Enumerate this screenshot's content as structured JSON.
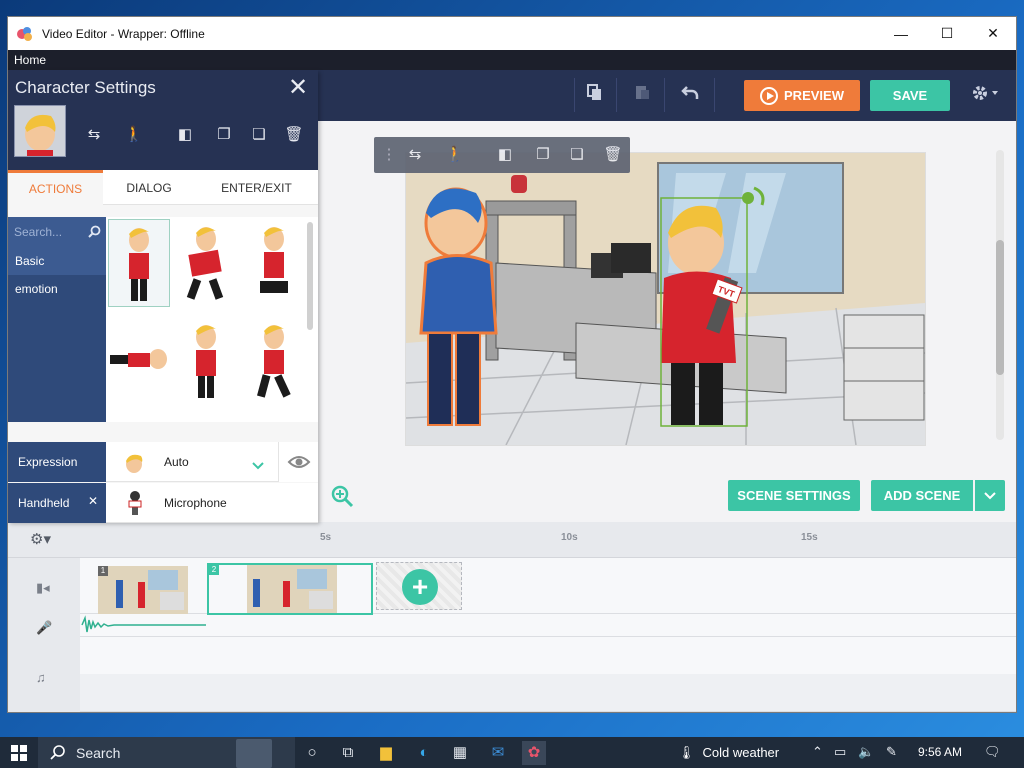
{
  "window": {
    "title": "Video Editor - Wrapper: Offline",
    "minimize": "—",
    "maximize": "☐",
    "close": "✕"
  },
  "menubar": {
    "home": "Home"
  },
  "toolbar": {
    "preview_label": "PREVIEW",
    "save_label": "SAVE"
  },
  "char_panel": {
    "title": "Character Settings",
    "close": "✕",
    "tabs": [
      "ACTIONS",
      "DIALOG",
      "ENTER/EXIT"
    ],
    "active_tab": "ACTIONS",
    "search_placeholder": "Search...",
    "categories": [
      "Basic",
      "emotion"
    ],
    "selected_category": "Basic",
    "expression_label": "Expression",
    "expression_value": "Auto",
    "handheld_label": "Handheld",
    "handheld_value": "Microphone",
    "handheld_clear": "✕"
  },
  "stage": {
    "scene_settings_label": "SCENE SETTINGS",
    "add_scene_label": "ADD SCENE",
    "mic_logo_text": "TVT"
  },
  "timeline": {
    "ticks": [
      "5s",
      "10s",
      "15s"
    ],
    "scenes": [
      {
        "number": "1"
      },
      {
        "number": "2"
      }
    ],
    "selected_scene": "2"
  },
  "taskbar": {
    "search_placeholder": "Search",
    "weather_text": "Cold weather",
    "time": "9:56 AM"
  },
  "colors": {
    "toolbar_bg": "#263253",
    "accent_orange": "#ef7b3a",
    "accent_teal": "#3cc5a5",
    "panel_category_bg": "#2f4a7a"
  }
}
